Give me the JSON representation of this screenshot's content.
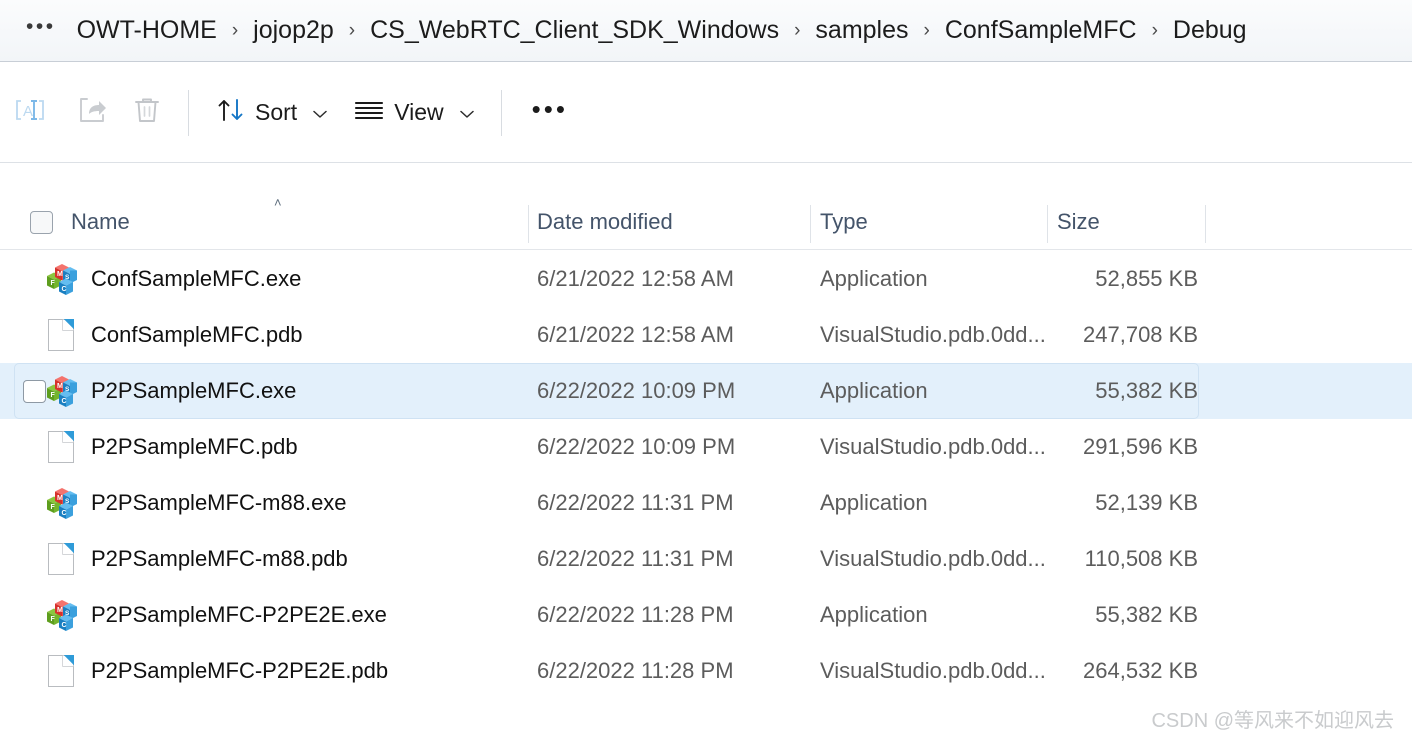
{
  "window": {
    "app": "File Explorer"
  },
  "breadcrumb": {
    "overflow_label": "•••",
    "separator": "›",
    "items": [
      {
        "label": "OWT-HOME"
      },
      {
        "label": "jojop2p"
      },
      {
        "label": "CS_WebRTC_Client_SDK_Windows"
      },
      {
        "label": "samples"
      },
      {
        "label": "ConfSampleMFC"
      },
      {
        "label": "Debug"
      }
    ]
  },
  "toolbar": {
    "rename_icon": "rename-icon",
    "share_icon": "share-icon",
    "delete_icon": "delete-icon",
    "sort_label": "Sort",
    "sort_icon": "sort-arrows-icon",
    "view_label": "View",
    "view_icon": "view-lines-icon",
    "caret": "⌄",
    "more_label": "•••"
  },
  "columns": {
    "select_all": "",
    "name": "Name",
    "date_modified": "Date modified",
    "type": "Type",
    "size": "Size",
    "sort_indicator": "˄",
    "sort_column": "Name",
    "sort_direction": "ascending"
  },
  "colors": {
    "selection_bg": "#e3f0fb",
    "selection_border": "#cfe2f3",
    "header_text": "#44546a",
    "row_text": "#111111",
    "meta_text": "#5c5c5c",
    "addressbar_bg": "#f2f5f8",
    "accent_blue": "#2f9bd8"
  },
  "files": [
    {
      "name": "ConfSampleMFC.exe",
      "icon": "mfc-application-icon",
      "date_modified": "6/21/2022 12:58 AM",
      "type": "Application",
      "size": "52,855 KB",
      "selected": false
    },
    {
      "name": "ConfSampleMFC.pdb",
      "icon": "generic-document-icon",
      "date_modified": "6/21/2022 12:58 AM",
      "type": "VisualStudio.pdb.0dd...",
      "size": "247,708 KB",
      "selected": false
    },
    {
      "name": "P2PSampleMFC.exe",
      "icon": "mfc-application-icon",
      "date_modified": "6/22/2022 10:09 PM",
      "type": "Application",
      "size": "55,382 KB",
      "selected": true
    },
    {
      "name": "P2PSampleMFC.pdb",
      "icon": "generic-document-icon",
      "date_modified": "6/22/2022 10:09 PM",
      "type": "VisualStudio.pdb.0dd...",
      "size": "291,596 KB",
      "selected": false
    },
    {
      "name": "P2PSampleMFC-m88.exe",
      "icon": "mfc-application-icon",
      "date_modified": "6/22/2022 11:31 PM",
      "type": "Application",
      "size": "52,139 KB",
      "selected": false
    },
    {
      "name": "P2PSampleMFC-m88.pdb",
      "icon": "generic-document-icon",
      "date_modified": "6/22/2022 11:31 PM",
      "type": "VisualStudio.pdb.0dd...",
      "size": "110,508 KB",
      "selected": false
    },
    {
      "name": "P2PSampleMFC-P2PE2E.exe",
      "icon": "mfc-application-icon",
      "date_modified": "6/22/2022 11:28 PM",
      "type": "Application",
      "size": "55,382 KB",
      "selected": false
    },
    {
      "name": "P2PSampleMFC-P2PE2E.pdb",
      "icon": "generic-document-icon",
      "date_modified": "6/22/2022 11:28 PM",
      "type": "VisualStudio.pdb.0dd...",
      "size": "264,532 KB",
      "selected": false
    }
  ],
  "watermark": {
    "text": "CSDN @等风来不如迎风去"
  }
}
